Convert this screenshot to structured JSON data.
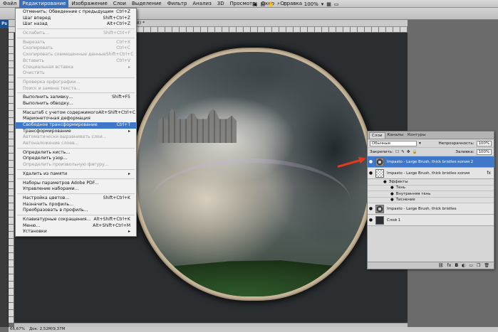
{
  "menubar": {
    "items": [
      "Файл",
      "Редактирование",
      "Изображение",
      "Слои",
      "Выделение",
      "Фильтр",
      "Анализ",
      "3D",
      "Просмотр",
      "Окно",
      "Справка"
    ],
    "zoom": "100%"
  },
  "document": {
    "tab_title": "/8) *",
    "status_zoom": "66,67%",
    "status_doc": "Док: 2,52M/9,37M"
  },
  "edit_menu": {
    "items": [
      {
        "label": "Отменить: Обведенние с предыдущим",
        "shortcut": "Ctrl+Z",
        "disabled": false
      },
      {
        "label": "Шаг вперед",
        "shortcut": "Shift+Ctrl+Z",
        "disabled": false
      },
      {
        "label": "Шаг назад",
        "shortcut": "Alt+Ctrl+Z",
        "disabled": false
      },
      {
        "sep": true
      },
      {
        "label": "Ослабить...",
        "shortcut": "Shift+Ctrl+F",
        "disabled": true
      },
      {
        "sep": true
      },
      {
        "label": "Вырезать",
        "shortcut": "Ctrl+X",
        "disabled": true
      },
      {
        "label": "Скопировать",
        "shortcut": "Ctrl+C",
        "disabled": true
      },
      {
        "label": "Скопировать совмещенные данные",
        "shortcut": "Shift+Ctrl+C",
        "disabled": true
      },
      {
        "label": "Вставить",
        "shortcut": "Ctrl+V",
        "disabled": true
      },
      {
        "label": "Специальная вставка",
        "shortcut": "",
        "arrow": true,
        "disabled": true
      },
      {
        "label": "Очистить",
        "shortcut": "",
        "disabled": true
      },
      {
        "sep": true
      },
      {
        "label": "Проверка орфографии...",
        "shortcut": "",
        "disabled": true
      },
      {
        "label": "Поиск и замена текста...",
        "shortcut": "",
        "disabled": true
      },
      {
        "sep": true
      },
      {
        "label": "Выполнить заливку...",
        "shortcut": "Shift+F5",
        "disabled": false
      },
      {
        "label": "Выполнить обводку...",
        "shortcut": "",
        "disabled": false
      },
      {
        "sep": true
      },
      {
        "label": "Масштаб с учетом содержимого",
        "shortcut": "Alt+Shift+Ctrl+C",
        "disabled": false
      },
      {
        "label": "Марионеточная деформация",
        "shortcut": "",
        "disabled": false
      },
      {
        "label": "Свободное трансформирование",
        "shortcut": "Ctrl+T",
        "disabled": false,
        "highlight": true
      },
      {
        "label": "Трансформирование",
        "shortcut": "",
        "arrow": true,
        "disabled": false
      },
      {
        "label": "Автоматически выравнивать слои...",
        "shortcut": "",
        "disabled": true
      },
      {
        "label": "Автоналожение слоев...",
        "shortcut": "",
        "disabled": true
      },
      {
        "sep": true
      },
      {
        "label": "Определить кисть...",
        "shortcut": "",
        "disabled": false
      },
      {
        "label": "Определить узор...",
        "shortcut": "",
        "disabled": false
      },
      {
        "label": "Определить произвольную фигуру...",
        "shortcut": "",
        "disabled": true
      },
      {
        "sep": true
      },
      {
        "label": "Удалить из памяти",
        "shortcut": "",
        "arrow": true,
        "disabled": false
      },
      {
        "sep": true
      },
      {
        "label": "Наборы параметров Adobe PDF...",
        "shortcut": "",
        "disabled": false
      },
      {
        "label": "Управление наборами...",
        "shortcut": "",
        "disabled": false
      },
      {
        "sep": true
      },
      {
        "label": "Настройка цветов...",
        "shortcut": "Shift+Ctrl+K",
        "disabled": false
      },
      {
        "label": "Назначить профиль...",
        "shortcut": "",
        "disabled": false
      },
      {
        "label": "Преобразовать в профиль...",
        "shortcut": "",
        "disabled": false
      },
      {
        "sep": true
      },
      {
        "label": "Клавиатурные сокращения...",
        "shortcut": "Alt+Shift+Ctrl+K",
        "disabled": false
      },
      {
        "label": "Меню...",
        "shortcut": "Alt+Shift+Ctrl+M",
        "disabled": false
      },
      {
        "label": "Установки",
        "shortcut": "",
        "arrow": true,
        "disabled": false
      }
    ]
  },
  "layers_panel": {
    "tabs": [
      "Слои",
      "Каналы",
      "Контуры"
    ],
    "blend_mode": "Обычные",
    "opacity_label": "Непрозрачность:",
    "opacity_value": "100%",
    "lock_label": "Закрепить:",
    "fill_label": "Заливка:",
    "fill_value": "100%",
    "layers": [
      {
        "name": "Impasto - Large Brush, thick bristles копия 2",
        "selected": true,
        "thumb": "circle"
      },
      {
        "name": "Impasto - Large Brush, thick bristles копия",
        "selected": false,
        "thumb": "trans",
        "fx": "fx"
      },
      {
        "name": "Impasto - Large Brush, thick bristles",
        "selected": false,
        "thumb": "circle"
      },
      {
        "name": "Слой 1",
        "selected": false,
        "thumb": "dark"
      }
    ],
    "effects_label": "Эффекты",
    "effects": [
      "Тень",
      "Внутренняя тень",
      "Тиснение"
    ]
  }
}
